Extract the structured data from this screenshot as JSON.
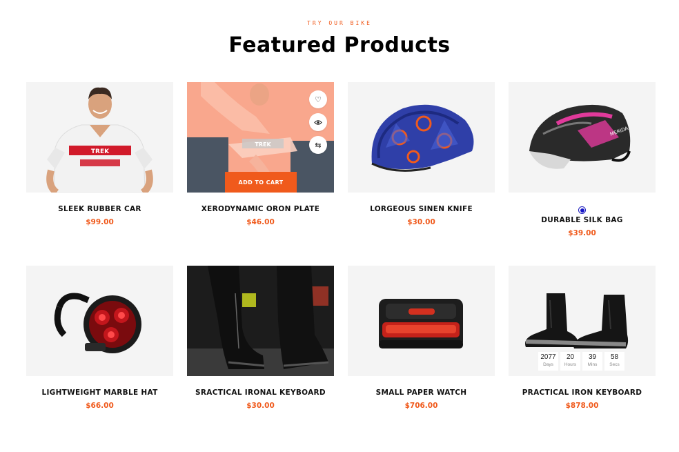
{
  "header": {
    "eyebrow": "TRY OUR BIKE",
    "title": "Featured Products"
  },
  "colors": {
    "accent": "#f05a1c",
    "tile_bg": "#f4f4f4"
  },
  "products": [
    {
      "name": "SLEEK RUBBER CAR",
      "price": "$99.00",
      "image": "cycling-jersey-rider"
    },
    {
      "name": "XERODYNAMIC ORON PLATE",
      "price": "$46.00",
      "image": "cycling-jersey-hover",
      "add_to_cart": "ADD TO CART",
      "actions": [
        "heart-icon",
        "eye-icon",
        "compare-icon"
      ]
    },
    {
      "name": "LORGEOUS SINEN KNIFE",
      "price": "$30.00",
      "image": "blue-kids-helmet"
    },
    {
      "name": "DURABLE SILK BAG",
      "price": "$39.00",
      "image": "black-pink-helmet"
    },
    {
      "name": "LIGHTWEIGHT MARBLE HAT",
      "price": "$66.00",
      "image": "red-bike-light"
    },
    {
      "name": "SRACTICAL IRONAL KEYBOARD",
      "price": "$30.00",
      "image": "cyclist-shoe-covers"
    },
    {
      "name": "SMALL PAPER WATCH",
      "price": "$706.00",
      "image": "red-tail-light"
    },
    {
      "name": "PRACTICAL IRON KEYBOARD",
      "price": "$878.00",
      "image": "overshoes",
      "countdown": [
        {
          "value": "2077",
          "label": "Days"
        },
        {
          "value": "20",
          "label": "Hours"
        },
        {
          "value": "39",
          "label": "Mins"
        },
        {
          "value": "58",
          "label": "Secs"
        }
      ]
    }
  ]
}
